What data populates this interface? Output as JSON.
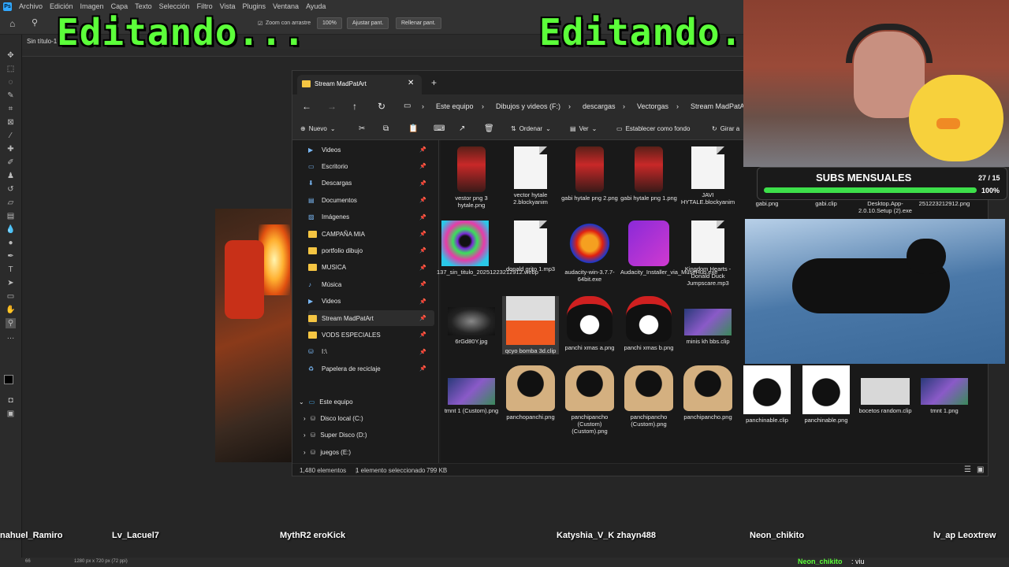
{
  "photoshop": {
    "menu": [
      "Archivo",
      "Edición",
      "Imagen",
      "Capa",
      "Texto",
      "Selección",
      "Filtro",
      "Vista",
      "Plugins",
      "Ventana",
      "Ayuda"
    ],
    "options": {
      "zoom_all_windows": "Zoom con arrastre",
      "zoom_level": "100%",
      "fit_button": "Ajustar pant.",
      "fill_button": "Rellenar pant."
    },
    "doc_tab": "Sin título-1",
    "status_zoom": "66",
    "status_size": "1280 px x 720 px (72 ppi)"
  },
  "overlay": {
    "left_text": "Editando...",
    "right_text": "Editando."
  },
  "explorer": {
    "tab_title": "Stream MadPatArt",
    "breadcrumb": [
      "Este equipo",
      "Dibujos y videos (F:)",
      "descargas",
      "Vectorgas",
      "Stream MadPatArt"
    ],
    "commands": {
      "new": "Nuevo",
      "sort": "Ordenar",
      "view": "Ver",
      "set_bg": "Establecer como fondo",
      "rotate": "Girar a"
    },
    "nav_pinned": [
      {
        "label": "Videos",
        "icon": "videos-icon"
      },
      {
        "label": "Escritorio",
        "icon": "desktop-icon"
      },
      {
        "label": "Descargas",
        "icon": "downloads-icon"
      },
      {
        "label": "Documentos",
        "icon": "documents-icon"
      },
      {
        "label": "Imágenes",
        "icon": "pictures-icon"
      },
      {
        "label": "CAMPAÑA MIA",
        "icon": "folder-icon"
      },
      {
        "label": "portfolio dibujo",
        "icon": "folder-icon"
      },
      {
        "label": "MUSICA",
        "icon": "folder-icon"
      },
      {
        "label": "Música",
        "icon": "music-icon"
      },
      {
        "label": "Videos",
        "icon": "videos-icon"
      },
      {
        "label": "Stream MadPatArt",
        "icon": "folder-icon"
      },
      {
        "label": "VODS ESPECIALES",
        "icon": "folder-icon"
      },
      {
        "label": "I:\\",
        "icon": "drive-icon"
      },
      {
        "label": "Papelera de reciclaje",
        "icon": "recycle-bin-icon"
      }
    ],
    "nav_tree": [
      {
        "label": "Este equipo"
      },
      {
        "label": "Disco local (C:)"
      },
      {
        "label": "Super Disco (D:)"
      },
      {
        "label": "juegos (E:)"
      }
    ],
    "files_row1": [
      {
        "name": "vestor png 3 hytale.png",
        "kind": "red-char"
      },
      {
        "name": "vector hytale 2.blockyanim",
        "kind": "doc"
      },
      {
        "name": "gabi hytale png 2.png",
        "kind": "red-char"
      },
      {
        "name": "gabi hytale png 1.png",
        "kind": "red-char"
      },
      {
        "name": "JAVI HYTALE.blockyanim",
        "kind": "doc"
      },
      {
        "name": "gabi.png",
        "kind": "hidden"
      },
      {
        "name": "gabi.clip",
        "kind": "hidden"
      },
      {
        "name": "Desktop.App-2.0.10.Setup (2).exe",
        "kind": "hidden"
      },
      {
        "name": "251223212912.png",
        "kind": "hidden"
      }
    ],
    "files_row2": [
      {
        "name": "137_sin_titulo_20251223212912.webp",
        "kind": "colorful"
      },
      {
        "name": "donald grito 1.mp3",
        "kind": "doc"
      },
      {
        "name": "audacity-win-3.7.7-64bit.exe",
        "kind": "audacity"
      },
      {
        "name": "Audacity_Installer_via_MuseHub.exe",
        "kind": "musehub"
      },
      {
        "name": "Kingdom Hearts - Donald Duck Jumpscare.mp3",
        "kind": "doc"
      }
    ],
    "files_row3": [
      {
        "name": "6rGd80Y.jpg",
        "kind": "dark"
      },
      {
        "name": "qcyo bomba 3d.clip",
        "kind": "bomb"
      },
      {
        "name": "panchi xmas a.png",
        "kind": "cat-xmas"
      },
      {
        "name": "panchi xmas b.png",
        "kind": "cat-xmas"
      },
      {
        "name": "minis kh bbs.clip",
        "kind": "scene"
      }
    ],
    "files_row4": [
      {
        "name": "tmnt 1 (Custom).png",
        "kind": "scene"
      },
      {
        "name": "panchopanchi.png",
        "kind": "cat-box"
      },
      {
        "name": "panchipancho (Custom) (Custom).png",
        "kind": "cat-box"
      },
      {
        "name": "panchipancho (Custom).png",
        "kind": "cat-box"
      },
      {
        "name": "panchipancho.png",
        "kind": "cat-box"
      },
      {
        "name": "panchinable.clip",
        "kind": "cat-head"
      },
      {
        "name": "panchinable.png",
        "kind": "cat-head"
      },
      {
        "name": "bocetos random.clip",
        "kind": "sketch"
      },
      {
        "name": "tmnt 1.png",
        "kind": "scene"
      }
    ],
    "status": {
      "count": "1,480 elementos",
      "selected": "1 elemento seleccionado",
      "size": "799 KB"
    }
  },
  "subs": {
    "title": "SUBS MENSUALES",
    "count": "27 / 15",
    "percent": "100%",
    "progress": 1.0
  },
  "chat": {
    "names": [
      "nahuel_Ramiro",
      "Lv_Lacuel7",
      "MythR2 eroKick",
      "Katyshia_V_K zhayn488",
      "Neon_chikito",
      "lv_ap Leoxtrew"
    ],
    "last_user": "Neon_chikito",
    "last_msg": ": viu"
  },
  "colors": {
    "accent_green": "#5cff3a",
    "ps_blue": "#31a8ff",
    "folder": "#f5c542"
  }
}
